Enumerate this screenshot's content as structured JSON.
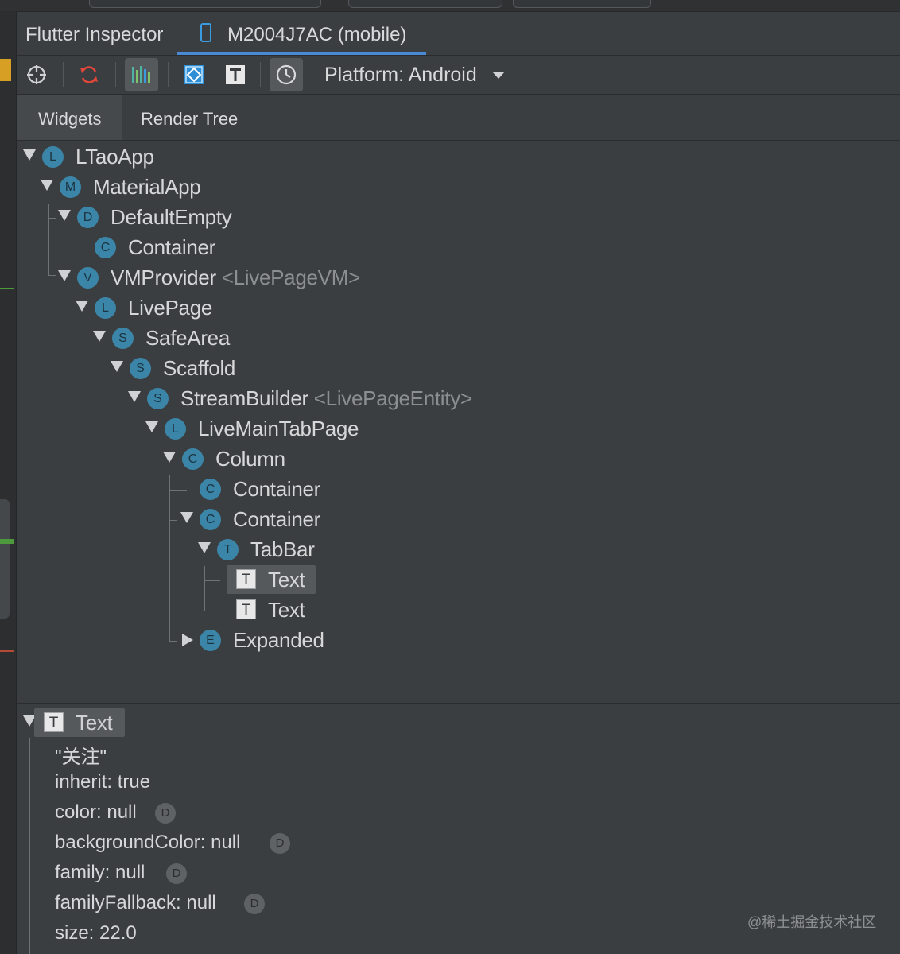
{
  "window": {
    "title": "Flutter Inspector",
    "device_tab": "M2004J7AC (mobile)"
  },
  "toolbar": {
    "platform_label": "Platform: Android",
    "icons": [
      "crosshair-icon",
      "refresh-icon",
      "performance-overlay-icon",
      "debug-paint-icon",
      "text-baseline-icon",
      "slow-animations-icon"
    ]
  },
  "subtabs": [
    "Widgets",
    "Render Tree"
  ],
  "tree": [
    {
      "name": "LTaoApp",
      "badge": "L",
      "expanded": true
    },
    {
      "name": "MaterialApp",
      "badge": "M",
      "expanded": true
    },
    {
      "name": "DefaultEmpty",
      "badge": "D",
      "expanded": true
    },
    {
      "name": "Container",
      "badge": "C",
      "expanded": false
    },
    {
      "name": "VMProvider",
      "badge": "V",
      "generic": "<LivePageVM>",
      "expanded": true
    },
    {
      "name": "LivePage",
      "badge": "L",
      "expanded": true
    },
    {
      "name": "SafeArea",
      "badge": "S",
      "expanded": true
    },
    {
      "name": "Scaffold",
      "badge": "S",
      "expanded": true
    },
    {
      "name": "StreamBuilder",
      "badge": "S",
      "generic": "<LivePageEntity>",
      "expanded": true
    },
    {
      "name": "LiveMainTabPage",
      "badge": "L",
      "expanded": true
    },
    {
      "name": "Column",
      "badge": "C",
      "expanded": true
    },
    {
      "name": "Container",
      "badge": "C",
      "expanded": false
    },
    {
      "name": "Container",
      "badge": "C",
      "expanded": true
    },
    {
      "name": "TabBar",
      "badge": "T",
      "expanded": true
    },
    {
      "name": "Text",
      "badge": "T",
      "selected": true
    },
    {
      "name": "Text",
      "badge": "T"
    },
    {
      "name": "Expanded",
      "badge": "E",
      "expanded": false
    }
  ],
  "details": {
    "header": "Text",
    "header_badge": "T",
    "value": "\"关注\"",
    "props": [
      {
        "text": "inherit: true",
        "badge": ""
      },
      {
        "text": "color: null",
        "badge": "D"
      },
      {
        "text": "backgroundColor: null",
        "badge": "D"
      },
      {
        "text": "family: null",
        "badge": "D"
      },
      {
        "text": "familyFallback: null",
        "badge": "D"
      },
      {
        "text": "size: 22.0",
        "badge": ""
      }
    ]
  },
  "watermark": "@稀土掘金技术社区",
  "colors": {
    "background": "#3b3e40",
    "accent_blue": "#4a8ad4",
    "badge_blue": "#3b86a8",
    "refresh_red": "#e0463a"
  }
}
